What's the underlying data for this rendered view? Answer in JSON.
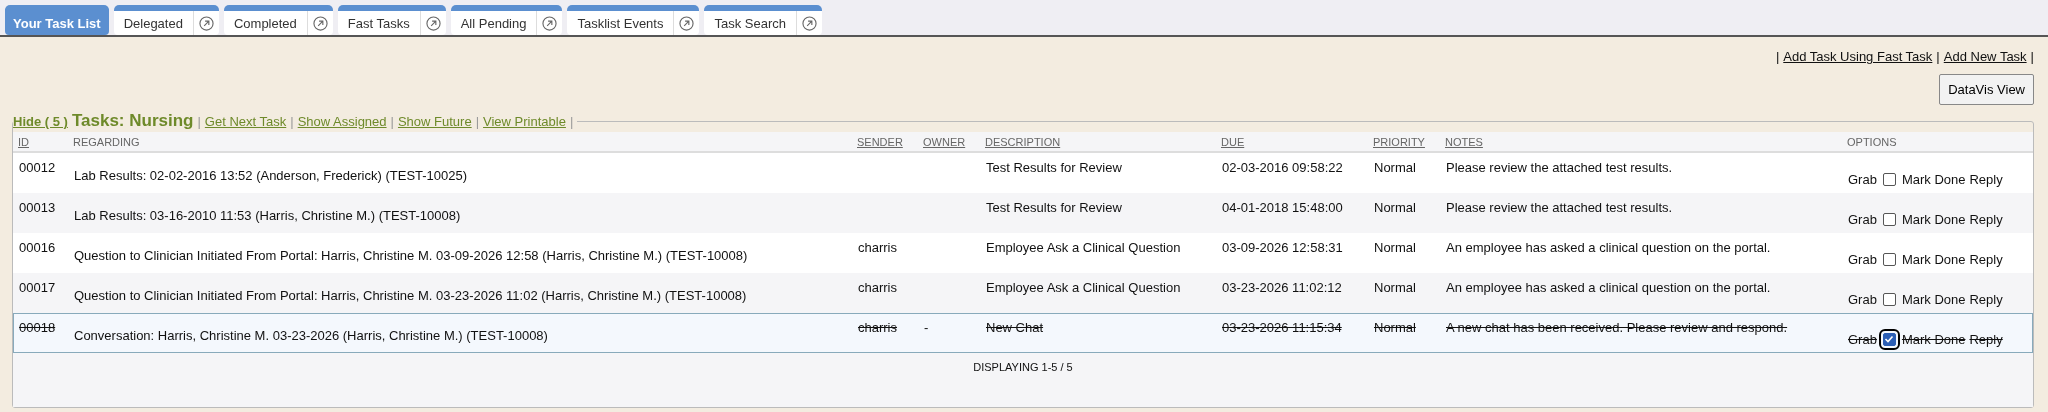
{
  "tabs": [
    {
      "label": "Your Task List",
      "selected": true
    },
    {
      "label": "Delegated",
      "selected": false
    },
    {
      "label": "Completed",
      "selected": false
    },
    {
      "label": "Fast Tasks",
      "selected": false
    },
    {
      "label": "All Pending",
      "selected": false
    },
    {
      "label": "Tasklist Events",
      "selected": false
    },
    {
      "label": "Task Search",
      "selected": false
    }
  ],
  "top_links": [
    {
      "kind": "separator",
      "text": "|"
    },
    {
      "kind": "link",
      "text": "Add Task Using Fast Task"
    },
    {
      "kind": "separator",
      "text": "|"
    },
    {
      "kind": "link",
      "text": "Add New Task"
    },
    {
      "kind": "separator",
      "text": "|"
    }
  ],
  "datavis_button": "DataVis View",
  "panel": {
    "hide_link": "Hide ( 5 )",
    "title": "Tasks: Nursing",
    "links": [
      {
        "kind": "separator",
        "text": "|"
      },
      {
        "kind": "link",
        "text": "Get Next Task"
      },
      {
        "kind": "separator",
        "text": "|"
      },
      {
        "kind": "link",
        "text": "Show Assigned"
      },
      {
        "kind": "separator",
        "text": "|"
      },
      {
        "kind": "link",
        "text": "Show Future"
      },
      {
        "kind": "separator",
        "text": "|"
      },
      {
        "kind": "link",
        "text": "View Printable"
      },
      {
        "kind": "separator",
        "text": "|"
      }
    ]
  },
  "table": {
    "columns": [
      {
        "label": "ID",
        "sortable": true
      },
      {
        "label": "REGARDING",
        "sortable": false
      },
      {
        "label": "SENDER",
        "sortable": true
      },
      {
        "label": "OWNER",
        "sortable": true
      },
      {
        "label": "DESCRIPTION",
        "sortable": true
      },
      {
        "label": "DUE",
        "sortable": true
      },
      {
        "label": "PRIORITY",
        "sortable": true
      },
      {
        "label": "NOTES",
        "sortable": true
      },
      {
        "label": "OPTIONS",
        "sortable": false
      }
    ],
    "rows": [
      {
        "id": "00012",
        "regarding": "Lab Results: 02-02-2016 13:52 (Anderson, Frederick) (TEST-10025)",
        "description": "Test Results for Review",
        "due": "02-03-2016 09:58:22",
        "priority": "Normal",
        "notes": "Please review the attached test results.",
        "grab": "Grab",
        "mark_done": "Mark Done",
        "reply": "Reply",
        "checked": false,
        "selected": false
      },
      {
        "id": "00013",
        "regarding": "Lab Results: 03-16-2010 11:53 (Harris, Christine M.) (TEST-10008)",
        "description": "Test Results for Review",
        "due": "04-01-2018 15:48:00",
        "priority": "Normal",
        "notes": "Please review the attached test results.",
        "grab": "Grab",
        "mark_done": "Mark Done",
        "reply": "Reply",
        "checked": false,
        "selected": false
      },
      {
        "id": "00016",
        "regarding": "Question to Clinician Initiated From Portal: Harris, Christine M. 03-09-2026 12:58 (Harris, Christine M.) (TEST-10008)",
        "sender": "charris",
        "description": "Employee Ask a Clinical Question",
        "due": "03-09-2026 12:58:31",
        "priority": "Normal",
        "notes": "An employee has asked a clinical question on the portal.",
        "grab": "Grab",
        "mark_done": "Mark Done",
        "reply": "Reply",
        "checked": false,
        "selected": false
      },
      {
        "id": "00017",
        "regarding": "Question to Clinician Initiated From Portal: Harris, Christine M. 03-23-2026 11:02 (Harris, Christine M.) (TEST-10008)",
        "sender": "charris",
        "description": "Employee Ask a Clinical Question",
        "due": "03-23-2026 11:02:12",
        "priority": "Normal",
        "notes": "An employee has asked a clinical question on the portal.",
        "grab": "Grab",
        "mark_done": "Mark Done",
        "reply": "Reply",
        "checked": false,
        "selected": false
      },
      {
        "id": "00018",
        "regarding": "Conversation: Harris, Christine M. 03-23-2026 (Harris, Christine M.) (TEST-10008)",
        "sender": "charris",
        "owner": "-",
        "description": "New Chat",
        "due": "03-23-2026 11:15:34",
        "priority": "Normal",
        "notes": "A new chat has been received. Please review and respond.",
        "grab": "Grab",
        "mark_done": "Mark Done",
        "reply": "Reply",
        "checked": true,
        "selected": true
      }
    ],
    "footer": "DISPLAYING 1-5 / 5"
  }
}
